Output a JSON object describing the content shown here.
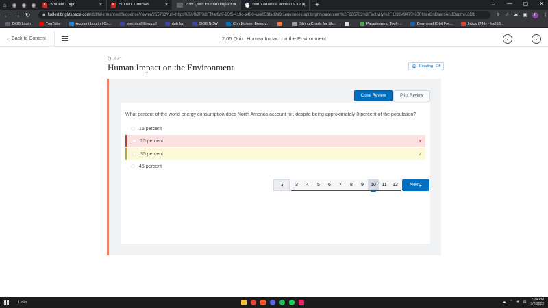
{
  "browser": {
    "tabs": [
      {
        "label": "",
        "fav": "#5f6368"
      },
      {
        "label": "",
        "fav": "#5f6368"
      },
      {
        "label": "",
        "fav": "#5f6368"
      },
      {
        "label": "Student Login",
        "fav": "#c62828",
        "fav_glyph": "K"
      },
      {
        "label": "Student Courses",
        "fav": "#c62828",
        "fav_glyph": "K"
      },
      {
        "label": "2.05 Quiz: Human Impact on the",
        "fav": "#5f6368",
        "fav_glyph": "BRX",
        "active": true
      },
      {
        "label": "north america accounts for appr",
        "fav": "#ffffff",
        "fav_glyph": "G"
      }
    ],
    "url_host": "fueled.brightspace.com",
    "url_path": "/d2l/le/enhancedSequenceViewer/265703?url=https%3A%2F%2Ff9af8a9-95f5-419c-a486-aee059fad9a3.sequences.api.brightspace.com%2F265703%2Factivity%2F12204947S%3FfilterOnDatesAndDepth%3D1",
    "profile_initial": "H",
    "bookmarks": [
      {
        "label": "DOB Login",
        "color": "#5f6368"
      },
      {
        "label": "YouTube",
        "color": "#ff0000"
      },
      {
        "label": "Account Log in | Co...",
        "color": "#1e88e5"
      },
      {
        "label": "electrical filing pdf",
        "color": "#3949ab"
      },
      {
        "label": "dob faq",
        "color": "#3949ab"
      },
      {
        "label": "DOB NOW",
        "color": "#3949ab"
      },
      {
        "label": "Con Edison: Energy...",
        "color": "#0277bd"
      },
      {
        "label": "",
        "color": "#ff7043"
      },
      {
        "label": "Sizing Charts for Sh...",
        "color": "#9e9e9e"
      },
      {
        "label": "",
        "color": "#e0e0e0"
      },
      {
        "label": "Paraphrasing Tool -...",
        "color": "#4caf50"
      },
      {
        "label": "Download IObit Fre...",
        "color": "#1565c0"
      },
      {
        "label": "Inbox (741) - ha263...",
        "color": "#ea4335"
      }
    ]
  },
  "nav": {
    "back_label": "Back to Content",
    "title": "2.05 Quiz: Human Impact on the Environment"
  },
  "quiz": {
    "label": "QUIZ:",
    "title": "Human Impact on the Environment",
    "reading_label": "Reading",
    "reading_state": "Off",
    "close_review": "Close Review",
    "print_review": "Print Review",
    "question": "What percent of the world energy consumption does North America account for, despite being approximately 8 percent of the population?",
    "options": [
      {
        "label": "15 percent",
        "state": "none"
      },
      {
        "label": "25 percent",
        "state": "wrong"
      },
      {
        "label": "35 percent",
        "state": "correct"
      },
      {
        "label": "45 percent",
        "state": "none"
      }
    ],
    "pages": [
      "3",
      "4",
      "5",
      "6",
      "7",
      "8",
      "9",
      "10",
      "11",
      "12"
    ],
    "current_page": "10",
    "next_label": "Next"
  },
  "taskbar": {
    "search_label": "Links",
    "time": "7:24 PM",
    "date": "7/7/2022"
  },
  "colors": {
    "primary": "#006fbf",
    "accent": "#f2836b",
    "wrong_bg": "#fbe0e0",
    "correct_bg": "#fcf9d9"
  }
}
